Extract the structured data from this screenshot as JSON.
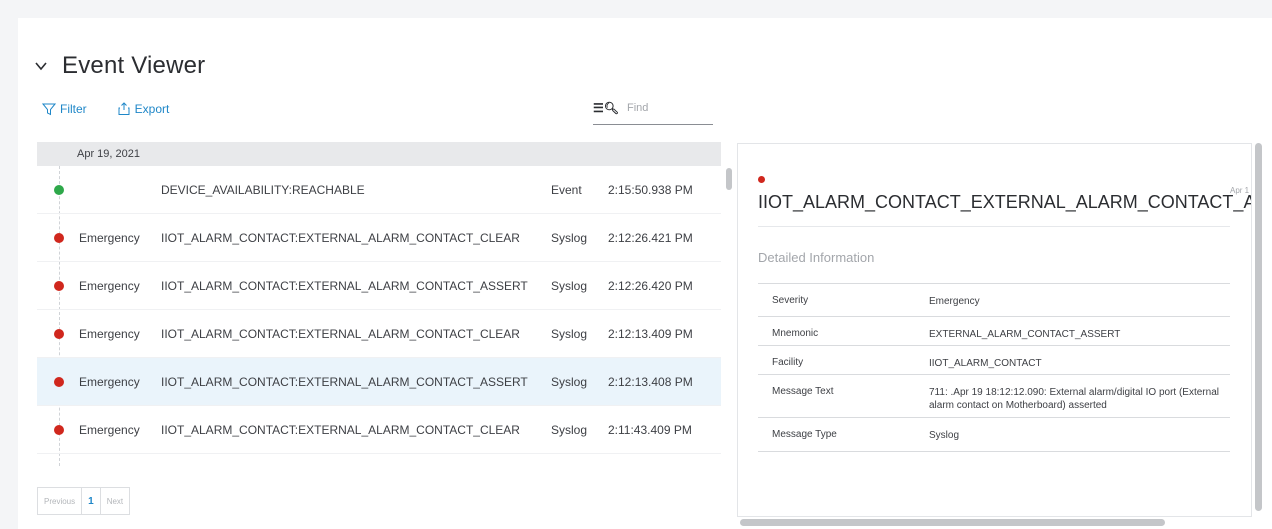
{
  "header": {
    "title": "Event Viewer"
  },
  "toolbar": {
    "filter_label": "Filter",
    "export_label": "Export"
  },
  "search": {
    "placeholder": "Find"
  },
  "events": {
    "date_group": "Apr 19, 2021",
    "rows": [
      {
        "severity": "",
        "message": "DEVICE_AVAILABILITY:REACHABLE",
        "type": "Event",
        "time": "2:15:50.938 PM",
        "status": "green"
      },
      {
        "severity": "Emergency",
        "message": "IIOT_ALARM_CONTACT:EXTERNAL_ALARM_CONTACT_CLEAR",
        "type": "Syslog",
        "time": "2:12:26.421 PM",
        "status": "red"
      },
      {
        "severity": "Emergency",
        "message": "IIOT_ALARM_CONTACT:EXTERNAL_ALARM_CONTACT_ASSERT",
        "type": "Syslog",
        "time": "2:12:26.420 PM",
        "status": "red"
      },
      {
        "severity": "Emergency",
        "message": "IIOT_ALARM_CONTACT:EXTERNAL_ALARM_CONTACT_CLEAR",
        "type": "Syslog",
        "time": "2:12:13.409 PM",
        "status": "red"
      },
      {
        "severity": "Emergency",
        "message": "IIOT_ALARM_CONTACT:EXTERNAL_ALARM_CONTACT_ASSERT",
        "type": "Syslog",
        "time": "2:12:13.408 PM",
        "status": "red",
        "selected": true
      },
      {
        "severity": "Emergency",
        "message": "IIOT_ALARM_CONTACT:EXTERNAL_ALARM_CONTACT_CLEAR",
        "type": "Syslog",
        "time": "2:11:43.409 PM",
        "status": "red"
      }
    ]
  },
  "pagination": {
    "previous": "Previous",
    "current": "1",
    "next": "Next"
  },
  "detail": {
    "title": "IIOT_ALARM_CONTACT_EXTERNAL_ALARM_CONTACT_ASSERT",
    "date_fragment": "Apr 1",
    "section_title": "Detailed Information",
    "fields": [
      {
        "key": "Severity",
        "value": "Emergency"
      },
      {
        "key": "Mnemonic",
        "value": "EXTERNAL_ALARM_CONTACT_ASSERT"
      },
      {
        "key": "Facility",
        "value": "IIOT_ALARM_CONTACT"
      },
      {
        "key": "Message Text",
        "value": "711: .Apr 19 18:12:12.090: External alarm/digital IO port (External alarm contact on Motherboard) asserted"
      },
      {
        "key": "Message Type",
        "value": "Syslog"
      }
    ]
  },
  "colors": {
    "accent": "#1f87c8",
    "emergency": "#d0271d",
    "ok": "#2ea84a",
    "selected_row": "#eaf4fb"
  }
}
